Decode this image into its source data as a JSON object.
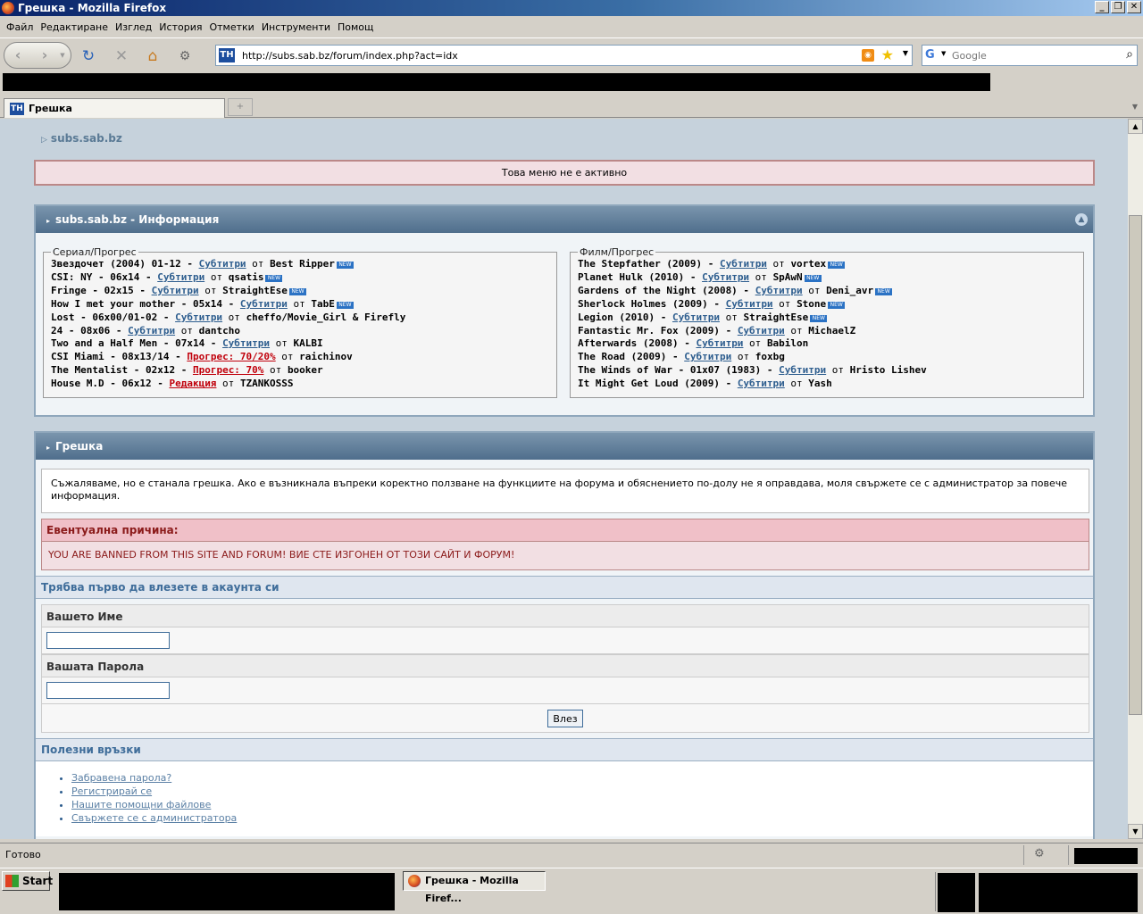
{
  "window": {
    "title": "Грешка - Mozilla Firefox",
    "buttons": [
      "_",
      "❐",
      "✕"
    ]
  },
  "menu": [
    "Файл",
    "Редактиране",
    "Изглед",
    "История",
    "Отметки",
    "Инструменти",
    "Помощ"
  ],
  "nav": {
    "url": "http://subs.sab.bz/forum/index.php?act=idx",
    "search_placeholder": "Google"
  },
  "tab": {
    "title": "Грешка"
  },
  "page": {
    "breadcrumb": "subs.sab.bz",
    "inactive_notice": "Това меню не е активно",
    "info_title": "subs.sab.bz - Информация",
    "series_legend": "Сериал/Прогрес",
    "films_legend": "Филм/Прогрес",
    "by": "от",
    "new_badge": "NEW",
    "series": [
      {
        "title": "Звездочет (2004) 01-12",
        "link": "Субтитри",
        "author": "Best Ripper",
        "new": true,
        "red": false
      },
      {
        "title": "CSI: NY - 06x14",
        "link": "Субтитри",
        "author": "qsatis",
        "new": true,
        "red": false
      },
      {
        "title": "Fringe - 02x15",
        "link": "Субтитри",
        "author": "StraightEse",
        "new": true,
        "red": false
      },
      {
        "title": "How I met your mother - 05x14",
        "link": "Субтитри",
        "author": "TabE",
        "new": true,
        "red": false
      },
      {
        "title": "Lost - 06x00/01-02",
        "link": "Субтитри",
        "author": "cheffo/Movie_Girl & Firefly",
        "new": false,
        "red": false
      },
      {
        "title": "24 - 08x06",
        "link": "Субтитри",
        "author": "dantcho",
        "new": false,
        "red": false
      },
      {
        "title": "Two and a Half Men - 07x14",
        "link": "Субтитри",
        "author": "KALBI",
        "new": false,
        "red": false
      },
      {
        "title": "CSI Miami - 08x13/14",
        "link": "Прогрес: 70/20%",
        "author": "raichinov",
        "new": false,
        "red": true
      },
      {
        "title": "The Mentalist - 02x12",
        "link": "Прогрес: 70%",
        "author": "booker",
        "new": false,
        "red": true
      },
      {
        "title": "House M.D - 06x12",
        "link": "Редакция",
        "author": "TZANKOSSS",
        "new": false,
        "red": true
      }
    ],
    "films": [
      {
        "title": "The Stepfather (2009)",
        "link": "Субтитри",
        "author": "vortex",
        "new": true
      },
      {
        "title": "Planet Hulk (2010)",
        "link": "Субтитри",
        "author": "SpAwN",
        "new": true
      },
      {
        "title": "Gardens of the Night (2008)",
        "link": "Субтитри",
        "author": "Deni_avr",
        "new": true
      },
      {
        "title": "Sherlock Holmes (2009)",
        "link": "Субтитри",
        "author": "Stone",
        "new": true
      },
      {
        "title": "Legion (2010)",
        "link": "Субтитри",
        "author": "StraightEse",
        "new": true
      },
      {
        "title": "Fantastic Mr. Fox (2009)",
        "link": "Субтитри",
        "author": "MichaelZ",
        "new": false
      },
      {
        "title": "Afterwards (2008)",
        "link": "Субтитри",
        "author": "Babilon",
        "new": false
      },
      {
        "title": "The Road (2009)",
        "link": "Субтитри",
        "author": "foxbg",
        "new": false
      },
      {
        "title": "The Winds of War - 01x07 (1983)",
        "link": "Субтитри",
        "author": "Hristo Lishev",
        "new": false
      },
      {
        "title": "It Might Get Loud (2009)",
        "link": "Субтитри",
        "author": "Yash",
        "new": false
      }
    ],
    "error_title": "Грешка",
    "error_message": "Съжаляваме, но е станала грешка. Ако е възникнала въпреки коректно ползване на функциите на форума и обяснението по-долу не я оправдава, моля свържете се с администратор за повече информация.",
    "reason_title": "Евентуална причина:",
    "reason_text": "YOU ARE BANNED FROM THIS SITE AND FORUM! ВИЕ СТЕ ИЗГОНЕН ОТ ТОЗИ САЙТ И ФОРУМ!",
    "login_header": "Трябва първо да влезете в акаунта си",
    "username_label": "Вашето Име",
    "password_label": "Вашата Парола",
    "login_button": "Влез",
    "links_header": "Полезни връзки",
    "links": [
      "Забравена парола?",
      "Регистрирай се",
      "Нашите помощни файлове",
      "Свържете се с администратора"
    ]
  },
  "status": {
    "text": "Готово"
  },
  "taskbar": {
    "start": "Start",
    "task": "Грешка - Mozilla Firef..."
  },
  "colors": {
    "accent": "#4f6e8c",
    "error": "#8b1a1a",
    "link": "#2d5d8e",
    "page_bg": "#c6d2dc"
  }
}
